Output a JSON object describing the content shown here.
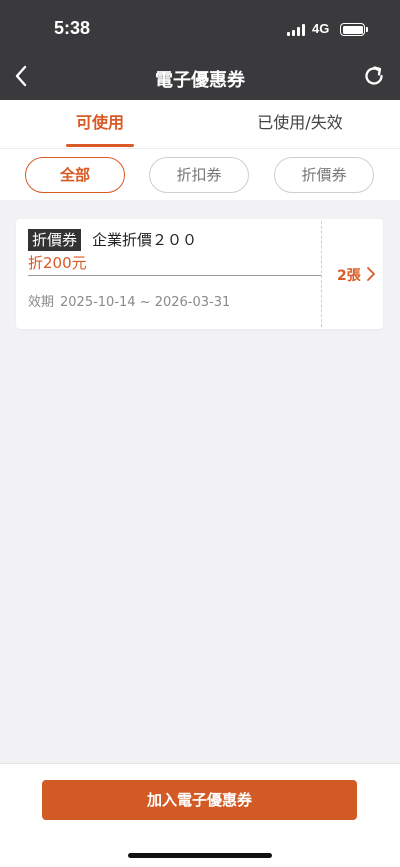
{
  "status_bar": {
    "time": "5:38",
    "network": "4G"
  },
  "nav": {
    "title": "電子優惠券",
    "back_icon": "chevron-left-icon",
    "refresh_icon": "refresh-icon"
  },
  "tabs": [
    {
      "label": "可使用",
      "active": true
    },
    {
      "label": "已使用/失效",
      "active": false
    }
  ],
  "filters": [
    {
      "label": "全部",
      "active": true
    },
    {
      "label": "折扣券",
      "active": false
    },
    {
      "label": "折價券",
      "active": false
    }
  ],
  "coupons": [
    {
      "type": "折價券",
      "name": "企業折價２００",
      "amount": "折200元",
      "validity_label": "效期",
      "validity_range": "2025-10-14 ~ 2026-03-31",
      "count": "2張"
    }
  ],
  "bottom": {
    "add_button_label": "加入電子優惠券"
  },
  "colors": {
    "accent": "#d95a25",
    "header_bg": "#3a3a3c",
    "page_bg": "#f2f2f4"
  }
}
